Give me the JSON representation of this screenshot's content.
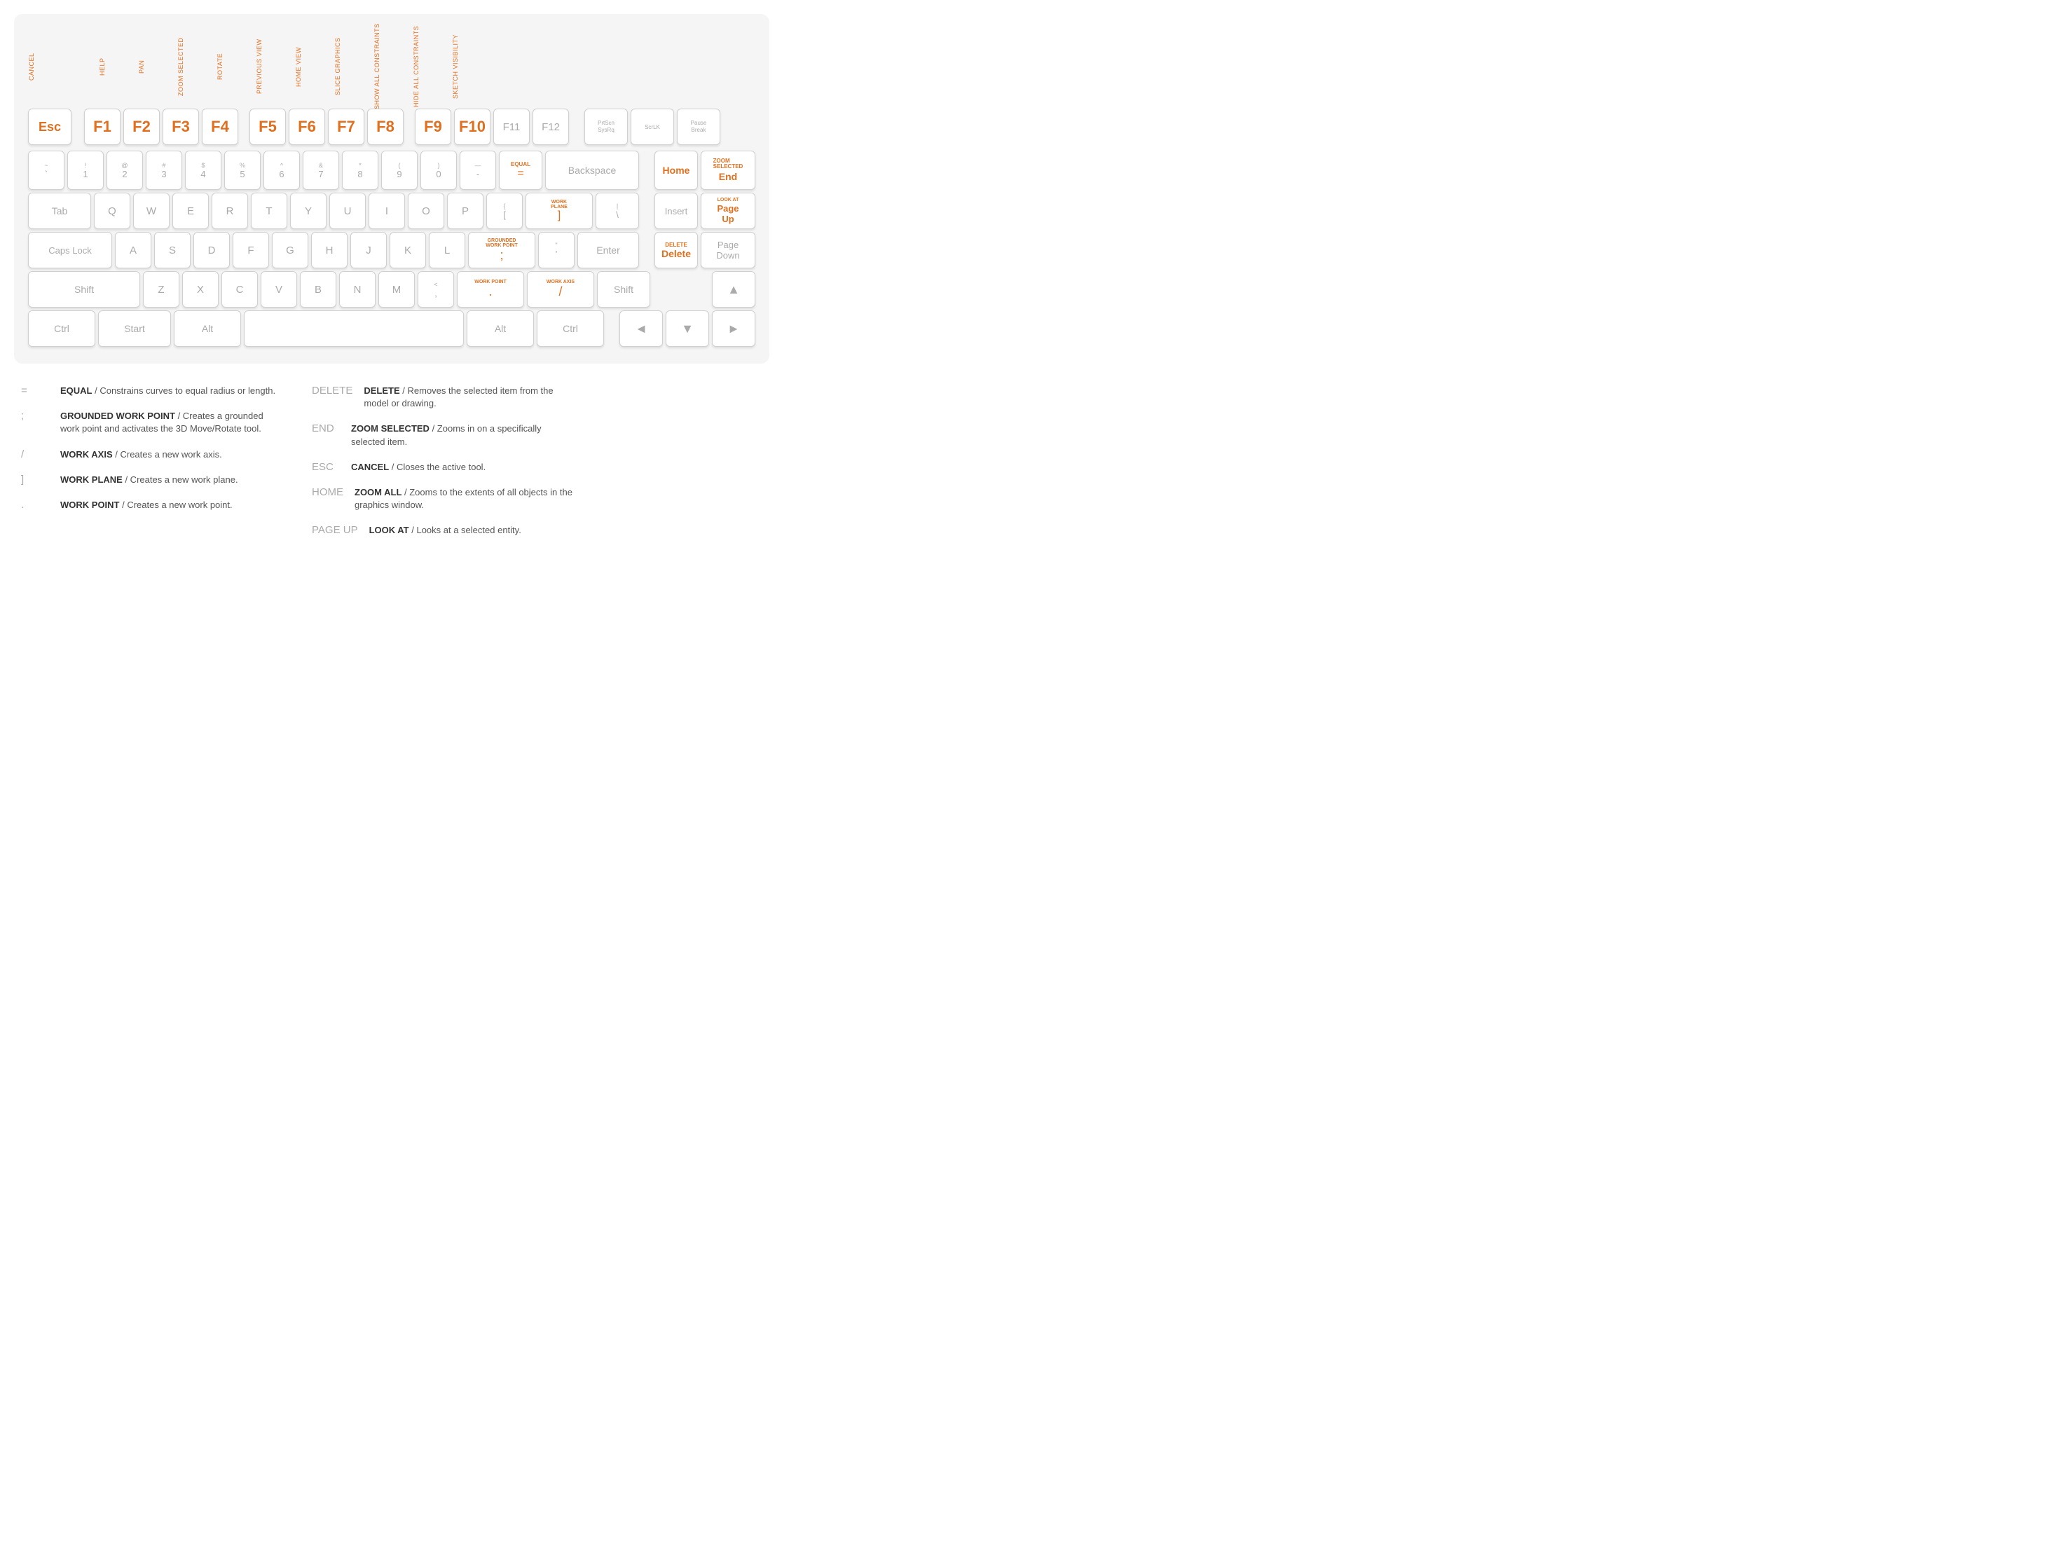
{
  "keyboard": {
    "fn_labels": [
      {
        "key": "F1",
        "label": "HELP"
      },
      {
        "key": "F2",
        "label": "PAN"
      },
      {
        "key": "F3",
        "label": "ZOOM SELECTED"
      },
      {
        "key": "F4",
        "label": "ROTATE"
      },
      {
        "key": "F5",
        "label": "PREVIOUS VIEW"
      },
      {
        "key": "F6",
        "label": "HOME VIEW"
      },
      {
        "key": "F7",
        "label": "SLICE GRAPHICS"
      },
      {
        "key": "F8",
        "label": "SHOW ALL CONSTRAINTS"
      },
      {
        "key": "F9",
        "label": "HIDE ALL CONSTRAINTS"
      },
      {
        "key": "F10",
        "label": "SKETCH VISIBILITY"
      }
    ],
    "esc_label": "CANCEL",
    "rows": {
      "fn_row": [
        "Esc",
        "F1",
        "F2",
        "F3",
        "F4",
        "F5",
        "F6",
        "F7",
        "F8",
        "F9",
        "F10",
        "F11",
        "F12"
      ],
      "fn_right": [
        "PrtScn\nSysRq",
        "ScrLK",
        "Pause\nBreak"
      ],
      "num_row": [
        {
          "top": "~",
          "bot": "`"
        },
        {
          "top": "!",
          "bot": "1"
        },
        {
          "top": "@",
          "bot": "2"
        },
        {
          "top": "#",
          "bot": "3"
        },
        {
          "top": "$",
          "bot": "4"
        },
        {
          "top": "%",
          "bot": "5"
        },
        {
          "top": "^",
          "bot": "6"
        },
        {
          "top": "&",
          "bot": "7"
        },
        {
          "top": "*",
          "bot": "8"
        },
        {
          "top": "(",
          "bot": "9"
        },
        {
          "top": ")",
          "bot": "0"
        },
        {
          "top": "—",
          "bot": "-"
        },
        {
          "top": "EQUAL",
          "bot": "=",
          "orange_top": true
        },
        "Backspace"
      ],
      "tab_row": [
        "Tab",
        "Q",
        "W",
        "E",
        "R",
        "T",
        "Y",
        "U",
        "I",
        "O",
        "P",
        "{  [",
        "] WORK PLANE",
        "\\  |"
      ],
      "caps_row": [
        "Caps Lock",
        "A",
        "S",
        "D",
        "F",
        "G",
        "H",
        "J",
        "K",
        "L",
        "; GROUNDED WORK POINT",
        "\"  '",
        "Enter"
      ],
      "shift_row": [
        "Shift",
        "Z",
        "X",
        "C",
        "V",
        "B",
        "N",
        "M",
        ",  <",
        ". WORK POINT",
        "/ WORK AXIS",
        "Shift"
      ],
      "ctrl_row": [
        "Ctrl",
        "Start",
        "Alt",
        "(space)",
        "Alt",
        "Ctrl"
      ]
    },
    "right_cluster": {
      "row1": [
        "Home",
        "End\nZOOM SELECTED"
      ],
      "row2": [
        "Insert",
        "Page Up\nLOOK AT"
      ],
      "row3": [
        "Delete\nDELETE",
        "Page Down"
      ],
      "row4": [
        "▲"
      ],
      "row5": [
        "◄",
        "▼",
        "►"
      ]
    }
  },
  "legend": {
    "left_items": [
      {
        "key": "=",
        "title": "EQUAL",
        "description": "Constrains curves to equal radius or length."
      },
      {
        "key": ";",
        "title": "GROUNDED WORK POINT",
        "description": "Creates a grounded work point and activates the 3D Move/Rotate tool."
      },
      {
        "key": "/",
        "title": "WORK AXIS",
        "description": "Creates a new work axis."
      },
      {
        "key": "]",
        "title": "WORK PLANE",
        "description": "Creates a new work plane."
      },
      {
        "key": ".",
        "title": "WORK POINT",
        "description": "Creates a new work point."
      }
    ],
    "right_items": [
      {
        "key": "DELETE",
        "title": "DELETE",
        "description": "Removes the selected item from the model or drawing."
      },
      {
        "key": "END",
        "title": "ZOOM SELECTED",
        "description": "Zooms in on a specifically selected item."
      },
      {
        "key": "ESC",
        "title": "CANCEL",
        "description": "Closes the active tool."
      },
      {
        "key": "HOME",
        "title": "ZOOM ALL",
        "description": "Zooms to the extents of all objects in the graphics window."
      },
      {
        "key": "PAGE UP",
        "title": "LOOK AT",
        "description": "Looks at a selected entity."
      }
    ]
  }
}
